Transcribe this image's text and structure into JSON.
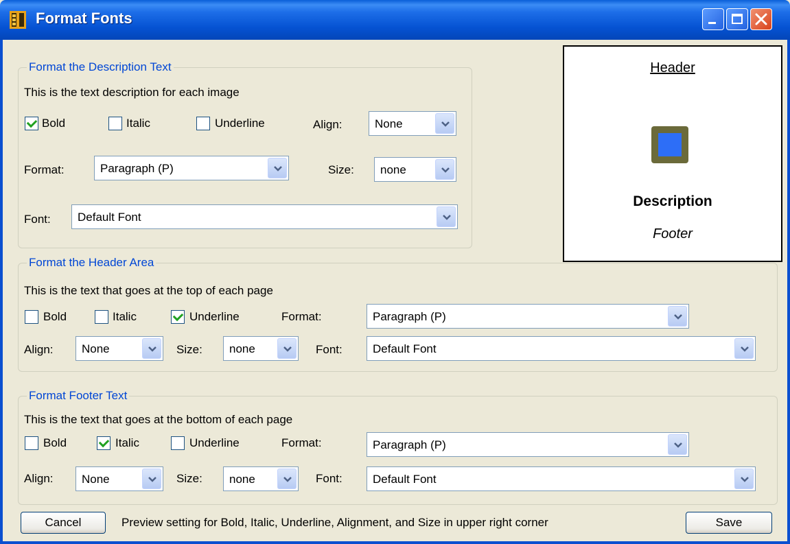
{
  "window": {
    "title": "Format Fonts"
  },
  "description_group": {
    "legend": "Format the Description Text",
    "info": "This is the text description for each image",
    "bold_label": "Bold",
    "bold_checked": true,
    "italic_label": "Italic",
    "italic_checked": false,
    "underline_label": "Underline",
    "underline_checked": false,
    "align_label": "Align:",
    "align_value": "None",
    "format_label": "Format:",
    "format_value": "Paragraph (P)",
    "size_label": "Size:",
    "size_value": "none",
    "font_label": "Font:",
    "font_value": "Default Font"
  },
  "preview": {
    "header": "Header",
    "description": "Description",
    "footer": "Footer",
    "image_icon": "image-placeholder-icon"
  },
  "header_group": {
    "legend": "Format the Header Area",
    "info": "This is the text that goes at the top of each page",
    "bold_label": "Bold",
    "bold_checked": false,
    "italic_label": "Italic",
    "italic_checked": false,
    "underline_label": "Underline",
    "underline_checked": true,
    "format_label": "Format:",
    "format_value": "Paragraph (P)",
    "align_label": "Align:",
    "align_value": "None",
    "size_label": "Size:",
    "size_value": "none",
    "font_label": "Font:",
    "font_value": "Default Font"
  },
  "footer_group": {
    "legend": "Format Footer Text",
    "info": "This is the text  that goes at the bottom of each page",
    "bold_label": "Bold",
    "bold_checked": false,
    "italic_label": "Italic",
    "italic_checked": true,
    "underline_label": "Underline",
    "underline_checked": false,
    "format_label": "Format:",
    "format_value": "Paragraph (P)",
    "align_label": "Align:",
    "align_value": "None",
    "size_label": "Size:",
    "size_value": "none",
    "font_label": "Font:",
    "font_value": "Default Font"
  },
  "footer_bar": {
    "cancel_label": "Cancel",
    "hint": "Preview setting for Bold, Italic, Underline,  Alignment, and Size in upper right corner",
    "save_label": "Save"
  },
  "colors": {
    "title_bar": "#0a5fd8",
    "legend_text": "#0046d5",
    "window_bg": "#ece9d8"
  }
}
